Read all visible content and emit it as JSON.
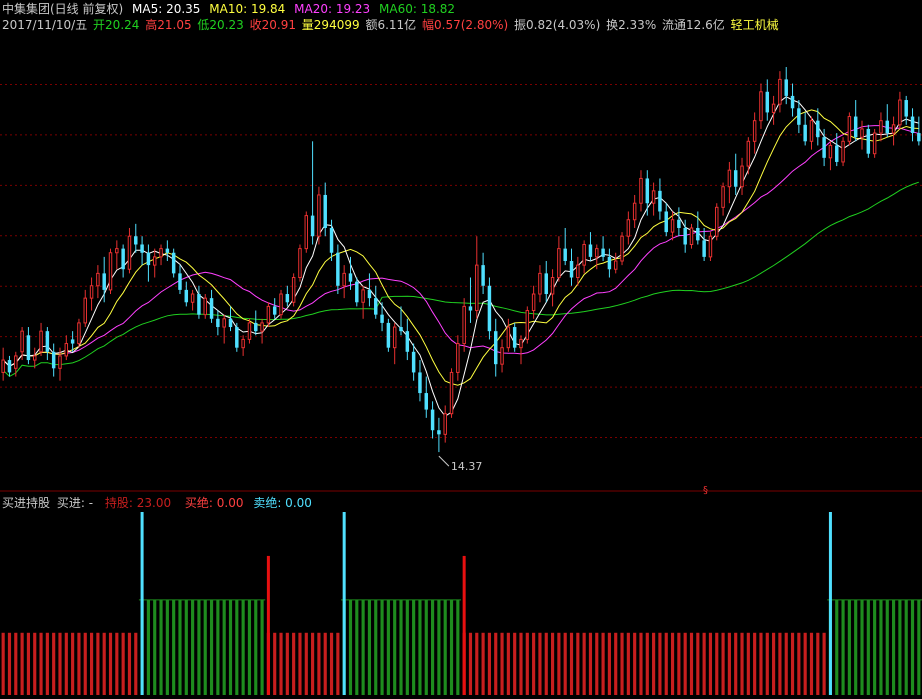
{
  "colors": {
    "bg": "#000000",
    "grid": "#7a0000",
    "up": "#e83030",
    "down": "#50e0ff",
    "ma5": "#ffffff",
    "ma10": "#ffff40",
    "ma20": "#ff40ff",
    "ma60": "#20d020",
    "hold": "#1e8c1e",
    "empty": "#c81e1e",
    "buy": "#50e0ff",
    "sell": "#e81010"
  },
  "header": {
    "title": "中集集团(日线 前复权)",
    "ma5": "MA5: 20.35",
    "ma10": "MA10: 19.84",
    "ma20": "MA20: 19.23",
    "ma60": "MA60: 18.82"
  },
  "quote": {
    "date": "2017/11/10/五",
    "open": "开20.24",
    "high": "高21.05",
    "low": "低20.23",
    "close": "收20.91",
    "volume": "量294099",
    "amount": "额6.11亿",
    "change": "幅0.57(2.80%)",
    "amplitude": "振0.82(4.03%)",
    "turnover": "换2.33%",
    "float": "流通12.6亿",
    "sector": "轻工机械"
  },
  "indicator": {
    "name": "买进持股",
    "buy_label": "买进: -",
    "hold_label": "持股: 23.00",
    "buy_abs": "买绝: 0.00",
    "sell_abs": "卖绝: 0.00"
  },
  "chart_data": [
    {
      "type": "candlestick",
      "ylim": [
        13.5,
        24.5
      ],
      "min_label": "14.37",
      "grid": true,
      "ohlc": [
        [
          16.3,
          16.9,
          16.1,
          16.6
        ],
        [
          16.6,
          16.7,
          16.2,
          16.3
        ],
        [
          16.4,
          16.8,
          16.2,
          16.7
        ],
        [
          16.8,
          17.4,
          16.6,
          17.3
        ],
        [
          17.2,
          17.4,
          16.5,
          16.6
        ],
        [
          16.6,
          16.9,
          16.4,
          16.7
        ],
        [
          16.8,
          17.5,
          16.7,
          17.3
        ],
        [
          17.3,
          17.4,
          16.6,
          16.8
        ],
        [
          16.8,
          17.0,
          16.2,
          16.4
        ],
        [
          16.4,
          16.9,
          16.1,
          16.7
        ],
        [
          16.7,
          17.2,
          16.6,
          17.0
        ],
        [
          17.1,
          17.3,
          16.8,
          17.0
        ],
        [
          17.0,
          17.6,
          16.9,
          17.5
        ],
        [
          17.5,
          18.3,
          17.4,
          18.1
        ],
        [
          18.1,
          18.6,
          17.8,
          18.4
        ],
        [
          18.4,
          18.9,
          18.1,
          18.7
        ],
        [
          18.7,
          19.1,
          18.0,
          18.3
        ],
        [
          18.3,
          19.3,
          18.2,
          19.2
        ],
        [
          19.2,
          19.5,
          18.8,
          19.3
        ],
        [
          19.3,
          19.4,
          18.6,
          18.8
        ],
        [
          18.8,
          19.8,
          18.7,
          19.6
        ],
        [
          19.6,
          19.9,
          19.2,
          19.4
        ],
        [
          19.4,
          19.6,
          18.9,
          19.2
        ],
        [
          19.2,
          19.4,
          18.5,
          18.9
        ],
        [
          18.9,
          19.3,
          18.6,
          19.1
        ],
        [
          19.1,
          19.4,
          18.9,
          19.3
        ],
        [
          19.3,
          19.5,
          19.0,
          19.2
        ],
        [
          19.2,
          19.3,
          18.6,
          18.7
        ],
        [
          18.7,
          18.9,
          18.2,
          18.3
        ],
        [
          18.3,
          18.5,
          17.9,
          18.0
        ],
        [
          18.0,
          18.3,
          17.8,
          18.2
        ],
        [
          18.2,
          18.4,
          17.6,
          17.7
        ],
        [
          17.7,
          18.2,
          17.6,
          18.1
        ],
        [
          18.1,
          18.3,
          17.5,
          17.6
        ],
        [
          17.6,
          17.8,
          17.2,
          17.4
        ],
        [
          17.4,
          17.7,
          17.0,
          17.6
        ],
        [
          17.6,
          17.9,
          17.3,
          17.4
        ],
        [
          17.4,
          17.5,
          16.8,
          16.9
        ],
        [
          16.9,
          17.2,
          16.7,
          17.1
        ],
        [
          17.1,
          17.6,
          17.0,
          17.5
        ],
        [
          17.5,
          17.8,
          17.2,
          17.3
        ],
        [
          17.3,
          17.6,
          17.0,
          17.5
        ],
        [
          17.5,
          18.0,
          17.4,
          17.9
        ],
        [
          17.9,
          18.1,
          17.6,
          17.7
        ],
        [
          17.7,
          18.3,
          17.6,
          18.2
        ],
        [
          18.2,
          18.4,
          17.9,
          18.0
        ],
        [
          18.0,
          18.7,
          17.9,
          18.6
        ],
        [
          18.6,
          19.4,
          18.5,
          19.3
        ],
        [
          19.3,
          20.2,
          19.2,
          20.1
        ],
        [
          20.1,
          21.9,
          19.4,
          19.6
        ],
        [
          19.6,
          20.8,
          19.4,
          20.6
        ],
        [
          20.6,
          20.9,
          19.6,
          19.8
        ],
        [
          19.8,
          20.0,
          19.0,
          19.2
        ],
        [
          19.2,
          19.4,
          18.2,
          18.4
        ],
        [
          18.4,
          18.9,
          18.1,
          18.7
        ],
        [
          18.7,
          19.1,
          18.3,
          18.5
        ],
        [
          18.5,
          18.6,
          17.9,
          18.0
        ],
        [
          18.0,
          18.4,
          17.6,
          18.3
        ],
        [
          18.3,
          18.7,
          17.9,
          18.1
        ],
        [
          18.1,
          18.4,
          17.6,
          17.7
        ],
        [
          17.7,
          18.0,
          17.3,
          17.5
        ],
        [
          17.5,
          17.6,
          16.8,
          16.9
        ],
        [
          16.9,
          17.5,
          16.5,
          17.4
        ],
        [
          17.4,
          17.9,
          17.2,
          17.3
        ],
        [
          17.3,
          17.6,
          16.6,
          16.8
        ],
        [
          16.8,
          17.0,
          16.1,
          16.3
        ],
        [
          16.3,
          16.6,
          15.6,
          15.8
        ],
        [
          15.8,
          16.2,
          15.2,
          15.4
        ],
        [
          15.4,
          15.6,
          14.7,
          14.9
        ],
        [
          14.9,
          15.2,
          14.37,
          14.8
        ],
        [
          14.8,
          15.5,
          14.6,
          15.3
        ],
        [
          15.3,
          16.4,
          15.2,
          16.3
        ],
        [
          16.3,
          17.2,
          16.1,
          17.0
        ],
        [
          17.0,
          18.1,
          16.8,
          17.9
        ],
        [
          17.9,
          18.6,
          17.5,
          17.8
        ],
        [
          17.8,
          19.6,
          17.6,
          18.9
        ],
        [
          18.9,
          19.2,
          18.2,
          18.4
        ],
        [
          18.4,
          18.6,
          17.1,
          17.3
        ],
        [
          17.3,
          17.6,
          16.2,
          16.5
        ],
        [
          16.5,
          17.1,
          16.3,
          16.9
        ],
        [
          16.9,
          17.6,
          16.8,
          17.4
        ],
        [
          17.4,
          17.5,
          16.8,
          16.9
        ],
        [
          16.9,
          17.2,
          16.5,
          17.1
        ],
        [
          17.1,
          17.9,
          17.0,
          17.8
        ],
        [
          17.8,
          18.4,
          17.6,
          18.2
        ],
        [
          18.2,
          18.9,
          18.0,
          18.7
        ],
        [
          18.7,
          19.0,
          18.0,
          18.2
        ],
        [
          18.2,
          18.8,
          17.9,
          18.6
        ],
        [
          18.6,
          19.6,
          18.5,
          19.3
        ],
        [
          19.3,
          19.8,
          18.9,
          19.0
        ],
        [
          19.0,
          19.3,
          18.4,
          18.6
        ],
        [
          18.6,
          19.1,
          18.4,
          18.9
        ],
        [
          18.9,
          19.5,
          18.7,
          19.4
        ],
        [
          19.4,
          19.7,
          19.0,
          19.1
        ],
        [
          19.1,
          19.4,
          18.8,
          19.3
        ],
        [
          19.3,
          19.6,
          19.0,
          19.1
        ],
        [
          19.1,
          19.3,
          18.6,
          18.8
        ],
        [
          18.8,
          19.2,
          18.7,
          19.0
        ],
        [
          19.0,
          19.7,
          18.9,
          19.6
        ],
        [
          19.6,
          20.2,
          19.4,
          20.0
        ],
        [
          20.0,
          20.6,
          19.8,
          20.4
        ],
        [
          20.4,
          21.2,
          20.2,
          21.0
        ],
        [
          21.0,
          21.2,
          20.1,
          20.4
        ],
        [
          20.4,
          20.9,
          20.1,
          20.7
        ],
        [
          20.7,
          21.0,
          20.0,
          20.2
        ],
        [
          20.2,
          20.4,
          19.6,
          19.7
        ],
        [
          19.7,
          20.2,
          19.5,
          20.0
        ],
        [
          20.0,
          20.3,
          19.6,
          19.8
        ],
        [
          19.8,
          20.0,
          19.2,
          19.4
        ],
        [
          19.4,
          19.9,
          19.3,
          19.8
        ],
        [
          19.8,
          20.2,
          19.4,
          19.5
        ],
        [
          19.5,
          19.8,
          19.0,
          19.1
        ],
        [
          19.1,
          19.7,
          19.0,
          19.6
        ],
        [
          19.6,
          20.4,
          19.5,
          20.3
        ],
        [
          20.3,
          20.9,
          20.1,
          20.8
        ],
        [
          20.8,
          21.4,
          20.4,
          21.2
        ],
        [
          21.2,
          21.6,
          20.6,
          20.8
        ],
        [
          20.8,
          21.5,
          20.6,
          21.3
        ],
        [
          21.3,
          22.0,
          21.1,
          21.9
        ],
        [
          21.9,
          22.6,
          21.6,
          22.4
        ],
        [
          22.4,
          23.3,
          22.2,
          23.1
        ],
        [
          23.1,
          23.4,
          22.4,
          22.6
        ],
        [
          22.6,
          23.0,
          22.3,
          22.8
        ],
        [
          22.8,
          23.6,
          22.6,
          23.4
        ],
        [
          23.4,
          23.7,
          22.8,
          23.0
        ],
        [
          23.0,
          23.3,
          22.5,
          22.7
        ],
        [
          22.7,
          22.9,
          22.1,
          22.3
        ],
        [
          22.3,
          22.6,
          21.8,
          21.9
        ],
        [
          21.9,
          22.5,
          21.7,
          22.4
        ],
        [
          22.4,
          22.7,
          21.8,
          22.0
        ],
        [
          22.0,
          22.2,
          21.3,
          21.5
        ],
        [
          21.5,
          21.9,
          21.2,
          21.8
        ],
        [
          21.8,
          22.1,
          21.3,
          21.4
        ],
        [
          21.4,
          22.0,
          21.3,
          21.9
        ],
        [
          21.9,
          22.6,
          21.8,
          22.5
        ],
        [
          22.5,
          22.9,
          21.9,
          22.0
        ],
        [
          22.0,
          22.4,
          21.7,
          22.2
        ],
        [
          22.2,
          22.3,
          21.5,
          21.6
        ],
        [
          21.6,
          22.2,
          21.5,
          22.1
        ],
        [
          22.1,
          22.6,
          21.9,
          22.4
        ],
        [
          22.4,
          22.8,
          22.0,
          22.1
        ],
        [
          22.1,
          22.5,
          21.8,
          22.3
        ],
        [
          22.3,
          23.1,
          22.2,
          22.9
        ],
        [
          22.9,
          23.0,
          22.3,
          22.5
        ],
        [
          22.5,
          22.7,
          21.9,
          22.1
        ],
        [
          22.1,
          22.5,
          21.8,
          21.9
        ]
      ]
    },
    {
      "type": "bar",
      "name": "买进持股",
      "ylim": [
        0,
        1
      ],
      "hold_level": 0.52,
      "empty_level": 0.34,
      "full_level": 1.0,
      "sell_level": 0.76,
      "hold_ranges": [
        [
          22,
          42
        ],
        [
          54,
          73
        ],
        [
          131,
          151
        ]
      ],
      "buy_days": [
        22,
        54,
        131
      ],
      "sell_days": [
        42,
        73
      ]
    }
  ]
}
